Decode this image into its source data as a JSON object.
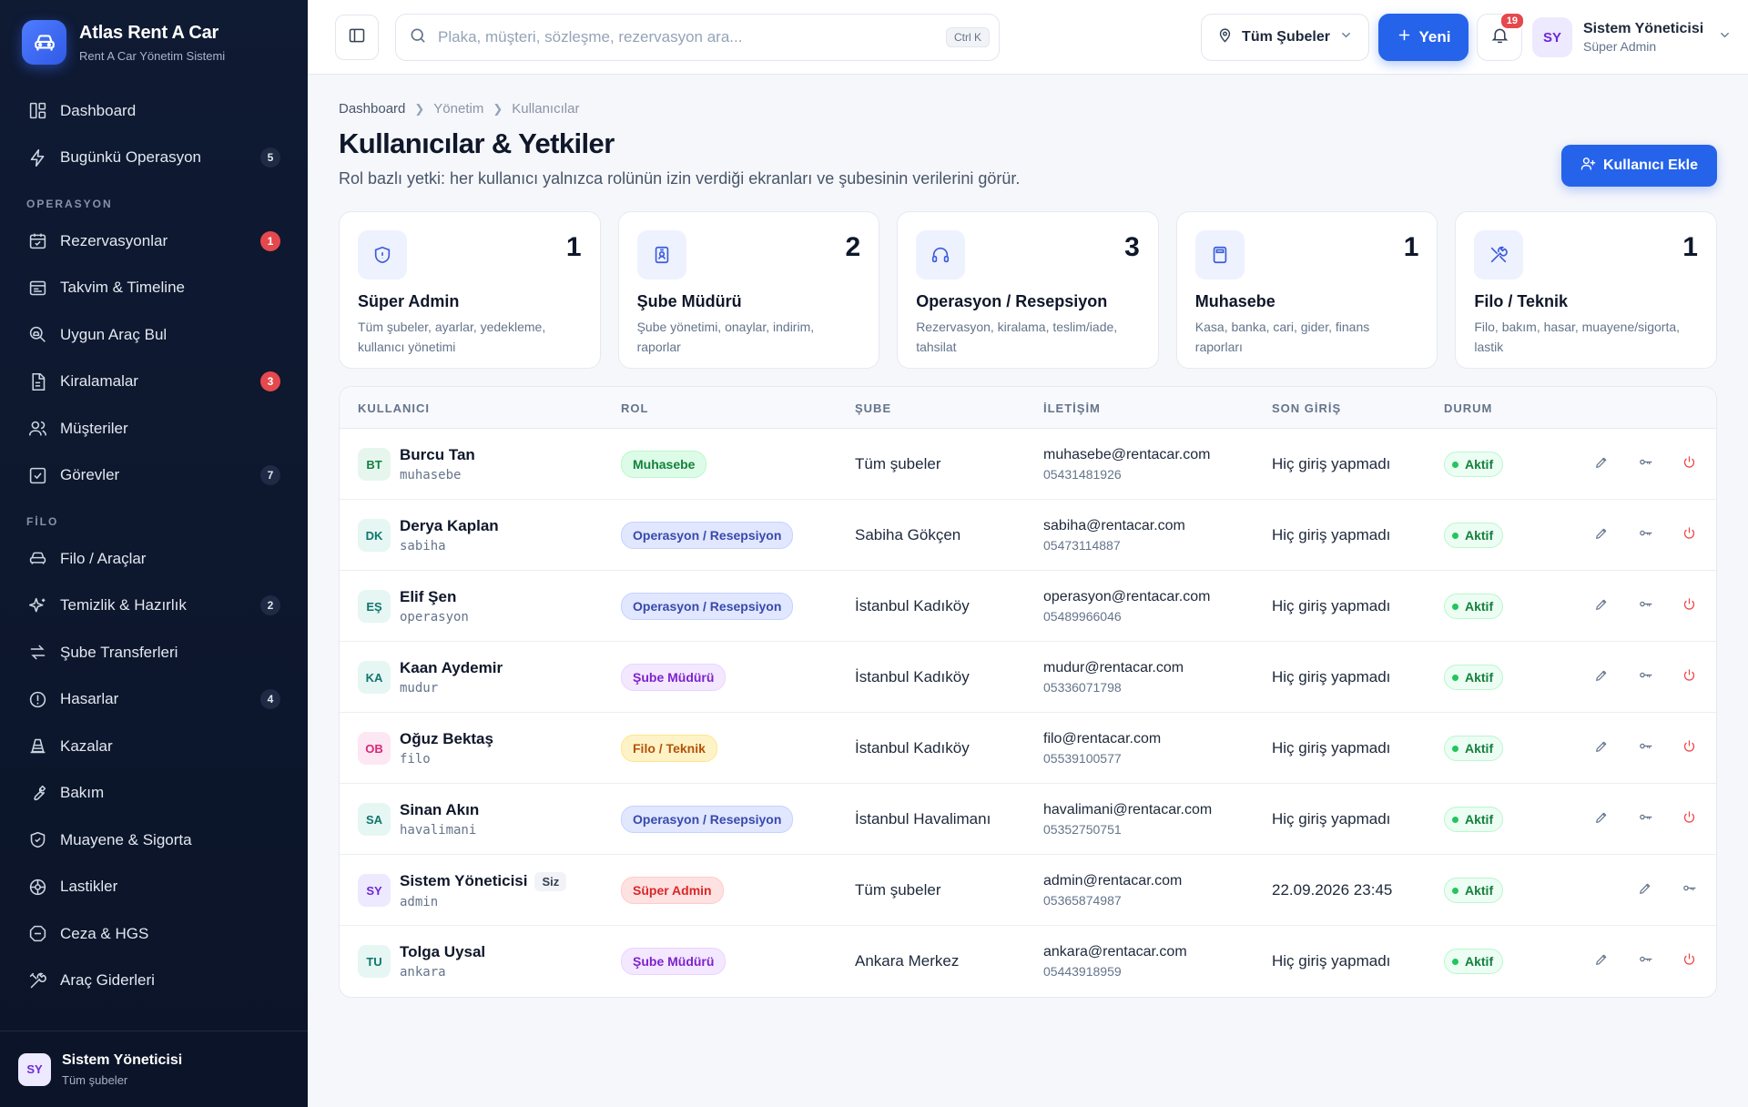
{
  "brand": {
    "title": "Atlas Rent A Car",
    "subtitle": "Rent A Car Yönetim Sistemi",
    "logo_icon": "car-icon"
  },
  "sidebar": {
    "items": [
      {
        "label": "Dashboard",
        "icon": "dashboard-icon"
      },
      {
        "label": "Bugünkü Operasyon",
        "icon": "bolt-icon",
        "count": "5"
      }
    ],
    "section_operasyon": "OPERASYON",
    "operasyon_items": [
      {
        "label": "Rezervasyonlar",
        "icon": "calendar-check-icon",
        "count": "1",
        "alert": true
      },
      {
        "label": "Takvim & Timeline",
        "icon": "timeline-icon"
      },
      {
        "label": "Uygun Araç Bul",
        "icon": "search-car-icon"
      },
      {
        "label": "Kiralamalar",
        "icon": "document-icon",
        "count": "3",
        "alert": true
      },
      {
        "label": "Müşteriler",
        "icon": "users-icon"
      },
      {
        "label": "Görevler",
        "icon": "checkbox-icon",
        "count": "7"
      }
    ],
    "section_filo": "FİLO",
    "filo_items": [
      {
        "label": "Filo / Araçlar",
        "icon": "car-icon"
      },
      {
        "label": "Temizlik & Hazırlık",
        "icon": "sparkle-icon",
        "count": "2"
      },
      {
        "label": "Şube Transferleri",
        "icon": "transfer-icon"
      },
      {
        "label": "Hasarlar",
        "icon": "alert-circle-icon",
        "count": "4"
      },
      {
        "label": "Kazalar",
        "icon": "cone-icon"
      },
      {
        "label": "Bakım",
        "icon": "wrench-icon"
      },
      {
        "label": "Muayene & Sigorta",
        "icon": "shield-icon"
      },
      {
        "label": "Lastikler",
        "icon": "tire-icon"
      },
      {
        "label": "Ceza & HGS",
        "icon": "stop-icon"
      },
      {
        "label": "Araç Giderleri",
        "icon": "tools-icon"
      }
    ],
    "footer": {
      "initials": "SY",
      "name": "Sistem Yöneticisi",
      "branch": "Tüm şubeler"
    }
  },
  "topbar": {
    "search_placeholder": "Plaka, müşteri, sözleşme, rezervasyon ara...",
    "search_shortcut": "Ctrl K",
    "branch_select": "Tüm Şubeler",
    "new_label": "Yeni",
    "notification_count": "19",
    "user": {
      "initials": "SY",
      "name": "Sistem Yöneticisi",
      "role": "Süper Admin"
    }
  },
  "breadcrumb": [
    "Dashboard",
    "Yönetim",
    "Kullanıcılar"
  ],
  "page": {
    "title": "Kullanıcılar & Yetkiler",
    "subtitle": "Rol bazlı yetki: her kullanıcı yalnızca rolünün izin verdiği ekranları ve şubesinin verilerini görür.",
    "add_button": "Kullanıcı Ekle"
  },
  "role_cards": [
    {
      "title": "Süper Admin",
      "count": "1",
      "desc": "Tüm şubeler, ayarlar, yedekleme, kullanıcı yönetimi",
      "icon": "shield-icon"
    },
    {
      "title": "Şube Müdürü",
      "count": "2",
      "desc": "Şube yönetimi, onaylar, indirim, raporlar",
      "icon": "badge-icon"
    },
    {
      "title": "Operasyon / Resepsiyon",
      "count": "3",
      "desc": "Rezervasyon, kiralama, teslim/iade, tahsilat",
      "icon": "headset-icon"
    },
    {
      "title": "Muhasebe",
      "count": "1",
      "desc": "Kasa, banka, cari, gider, finans raporları",
      "icon": "calculator-icon"
    },
    {
      "title": "Filo / Teknik",
      "count": "1",
      "desc": "Filo, bakım, hasar, muayene/sigorta, lastik",
      "icon": "tools-icon"
    }
  ],
  "table": {
    "headers": [
      "KULLANICI",
      "ROL",
      "ŞUBE",
      "İLETİŞİM",
      "SON GİRİŞ",
      "DURUM"
    ],
    "rows": [
      {
        "initials": "BT",
        "name": "Burcu Tan",
        "username": "muhasebe",
        "role": "Muhasebe",
        "role_key": "muhasebe",
        "branch": "Tüm şubeler",
        "email": "muhasebe@rentacar.com",
        "phone": "05431481926",
        "last_login": "Hiç giriş yapmadı",
        "status": "Aktif",
        "me": false,
        "me_label": ""
      },
      {
        "initials": "DK",
        "name": "Derya Kaplan",
        "username": "sabiha",
        "role": "Operasyon / Resepsiyon",
        "role_key": "operasyon",
        "branch": "Sabiha Gökçen",
        "email": "sabiha@rentacar.com",
        "phone": "05473114887",
        "last_login": "Hiç giriş yapmadı",
        "status": "Aktif",
        "me": false,
        "me_label": ""
      },
      {
        "initials": "EŞ",
        "name": "Elif Şen",
        "username": "operasyon",
        "role": "Operasyon / Resepsiyon",
        "role_key": "operasyon",
        "branch": "İstanbul Kadıköy",
        "email": "operasyon@rentacar.com",
        "phone": "05489966046",
        "last_login": "Hiç giriş yapmadı",
        "status": "Aktif",
        "me": false,
        "me_label": ""
      },
      {
        "initials": "KA",
        "name": "Kaan Aydemir",
        "username": "mudur",
        "role": "Şube Müdürü",
        "role_key": "mudur",
        "branch": "İstanbul Kadıköy",
        "email": "mudur@rentacar.com",
        "phone": "05336071798",
        "last_login": "Hiç giriş yapmadı",
        "status": "Aktif",
        "me": false,
        "me_label": ""
      },
      {
        "initials": "OB",
        "name": "Oğuz Bektaş",
        "username": "filo",
        "role": "Filo / Teknik",
        "role_key": "filo",
        "branch": "İstanbul Kadıköy",
        "email": "filo@rentacar.com",
        "phone": "05539100577",
        "last_login": "Hiç giriş yapmadı",
        "status": "Aktif",
        "me": false,
        "me_label": ""
      },
      {
        "initials": "SA",
        "name": "Sinan Akın",
        "username": "havalimani",
        "role": "Operasyon / Resepsiyon",
        "role_key": "operasyon",
        "branch": "İstanbul Havalimanı",
        "email": "havalimani@rentacar.com",
        "phone": "05352750751",
        "last_login": "Hiç giriş yapmadı",
        "status": "Aktif",
        "me": false,
        "me_label": ""
      },
      {
        "initials": "SY",
        "name": "Sistem Yöneticisi",
        "username": "admin",
        "role": "Süper Admin",
        "role_key": "admin",
        "branch": "Tüm şubeler",
        "email": "admin@rentacar.com",
        "phone": "05365874987",
        "last_login": "22.09.2026 23:45",
        "status": "Aktif",
        "me": true,
        "me_label": "Siz"
      },
      {
        "initials": "TU",
        "name": "Tolga Uysal",
        "username": "ankara",
        "role": "Şube Müdürü",
        "role_key": "mudur",
        "branch": "Ankara Merkez",
        "email": "ankara@rentacar.com",
        "phone": "05443918959",
        "last_login": "Hiç giriş yapmadı",
        "status": "Aktif",
        "me": false,
        "me_label": ""
      }
    ]
  },
  "colors": {
    "accent": "#2563eb",
    "sidebar_bg": "#0f1a33",
    "badge_alert": "#e5484d",
    "status_active": "#15803d"
  }
}
